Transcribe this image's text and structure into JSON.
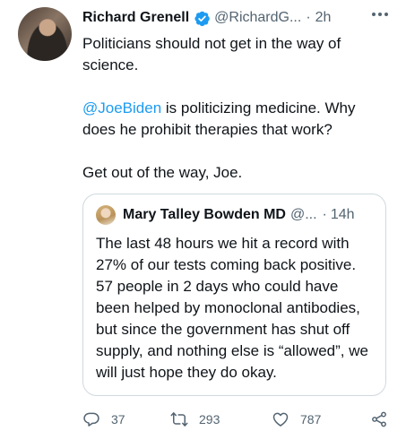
{
  "author": {
    "name": "Richard Grenell",
    "handle": "@RichardG...",
    "separator": "·",
    "time": "2h"
  },
  "tweet": {
    "line1": "Politicians should not get in the way of science.",
    "mention": "@JoeBiden",
    "line2_rest": " is politicizing medicine. Why does he prohibit therapies that work?",
    "line3": "Get out of the way, Joe."
  },
  "quote": {
    "name": "Mary Talley Bowden MD",
    "handle": "@...",
    "separator": "·",
    "time": "14h",
    "text": "The last 48 hours we hit a record with 27% of our tests coming back positive. 57 people in 2 days who could have been helped by monoclonal antibodies, but since the government has shut off supply, and nothing else is “allowed”, we will just hope they do okay."
  },
  "actions": {
    "replies": "37",
    "retweets": "293",
    "likes": "787"
  },
  "icons": {
    "verified": "verified-badge-icon",
    "more": "more-dots-icon",
    "reply": "reply-icon",
    "retweet": "retweet-icon",
    "like": "heart-icon",
    "share": "share-icon"
  },
  "colors": {
    "accent": "#1d9bf0",
    "secondary_text": "#536471",
    "border": "#cfd9de"
  }
}
